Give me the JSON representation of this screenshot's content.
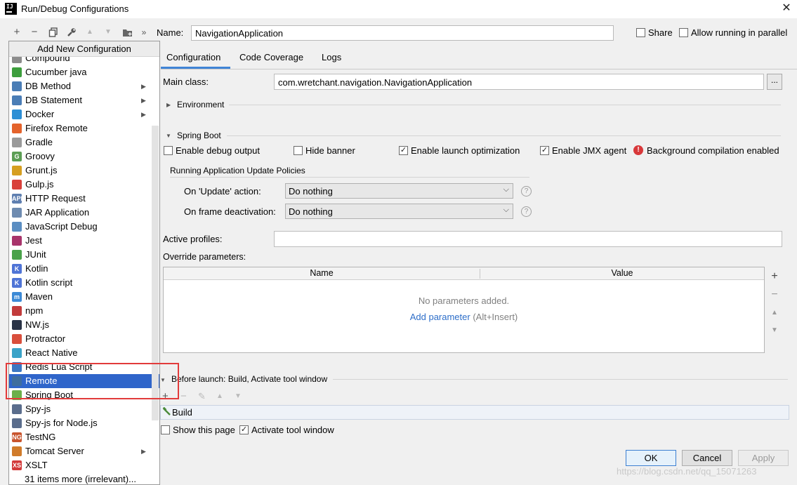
{
  "window": {
    "title": "Run/Debug Configurations",
    "logo_text": "IJ",
    "close_glyph": "✕"
  },
  "toolbar": {
    "icons": [
      "plus-icon",
      "minus-icon",
      "copy-icon",
      "wrench-icon",
      "arrow-up-icon",
      "arrow-down-icon",
      "folder-plus-icon",
      "double-chevron-right-icon"
    ],
    "name_label": "Name:",
    "name_value": "NavigationApplication",
    "share_label": "Share",
    "allow_parallel_label": "Allow running in parallel"
  },
  "popup": {
    "header": "Add New Configuration",
    "items": [
      {
        "label": "Compound",
        "icon": "compound-icon",
        "color": "#8c8c8c"
      },
      {
        "label": "Cucumber java",
        "icon": "cucumber-icon",
        "color": "#3d9e3d"
      },
      {
        "label": "DB Method",
        "icon": "db-method-icon",
        "color": "#4a7db6",
        "submenu": true
      },
      {
        "label": "DB Statement",
        "icon": "db-statement-icon",
        "color": "#4a7db6",
        "submenu": true
      },
      {
        "label": "Docker",
        "icon": "docker-icon",
        "color": "#2d8fd5",
        "submenu": true
      },
      {
        "label": "Firefox Remote",
        "icon": "firefox-icon",
        "color": "#e4632c"
      },
      {
        "label": "Gradle",
        "icon": "gradle-icon",
        "color": "#9a9a9a"
      },
      {
        "label": "Groovy",
        "icon": "groovy-icon",
        "color": "#5c9e55",
        "glyph": "G"
      },
      {
        "label": "Grunt.js",
        "icon": "grunt-icon",
        "color": "#d69f21"
      },
      {
        "label": "Gulp.js",
        "icon": "gulp-icon",
        "color": "#d9403a"
      },
      {
        "label": "HTTP Request",
        "icon": "http-request-icon",
        "color": "#5f7fb0",
        "glyph": "API"
      },
      {
        "label": "JAR Application",
        "icon": "jar-icon",
        "color": "#6e8bb0"
      },
      {
        "label": "JavaScript Debug",
        "icon": "javascript-debug-icon",
        "color": "#5b8ec2"
      },
      {
        "label": "Jest",
        "icon": "jest-icon",
        "color": "#a8346b"
      },
      {
        "label": "JUnit",
        "icon": "junit-icon",
        "color": "#4aa24a"
      },
      {
        "label": "Kotlin",
        "icon": "kotlin-icon",
        "color": "#4f74d6",
        "glyph": "K"
      },
      {
        "label": "Kotlin script",
        "icon": "kotlin-script-icon",
        "color": "#4f74d6",
        "glyph": "K"
      },
      {
        "label": "Maven",
        "icon": "maven-icon",
        "color": "#3c8ad6",
        "glyph": "m"
      },
      {
        "label": "npm",
        "icon": "npm-icon",
        "color": "#c23b3b"
      },
      {
        "label": "NW.js",
        "icon": "nwjs-icon",
        "color": "#2a3346"
      },
      {
        "label": "Protractor",
        "icon": "protractor-icon",
        "color": "#d94f3c"
      },
      {
        "label": "React Native",
        "icon": "react-native-icon",
        "color": "#3aa3c8"
      },
      {
        "label": "Redis Lua Script",
        "icon": "redis-lua-icon",
        "color": "#3d77c2"
      },
      {
        "label": "Remote",
        "icon": "remote-icon",
        "color": "#3e6d9e",
        "selected": true
      },
      {
        "label": "Spring Boot",
        "icon": "spring-boot-icon",
        "color": "#6bb04a"
      },
      {
        "label": "Spy-js",
        "icon": "spy-js-icon",
        "color": "#5a6d8c"
      },
      {
        "label": "Spy-js for Node.js",
        "icon": "spy-js-node-icon",
        "color": "#5a6d8c"
      },
      {
        "label": "TestNG",
        "icon": "testng-icon",
        "color": "#c9552e",
        "glyph": "NG"
      },
      {
        "label": "Tomcat Server",
        "icon": "tomcat-icon",
        "color": "#d07b2a",
        "submenu": true
      },
      {
        "label": "XSLT",
        "icon": "xslt-icon",
        "color": "#d33b3b",
        "glyph": "XS"
      },
      {
        "label": "31 items more (irrelevant)...",
        "icon": "",
        "color": "#ffffff"
      }
    ]
  },
  "tabs": [
    {
      "label": "Configuration",
      "active": true
    },
    {
      "label": "Code Coverage"
    },
    {
      "label": "Logs"
    }
  ],
  "config": {
    "main_class_label": "Main class:",
    "main_class_value": "com.wretchant.navigation.NavigationApplication",
    "browse_label": "...",
    "environment_label": "Environment",
    "spring_boot_label": "Spring Boot",
    "checkboxes": [
      {
        "label": "Enable debug output",
        "checked": false
      },
      {
        "label": "Hide banner",
        "checked": false
      },
      {
        "label": "Enable launch optimization",
        "checked": true
      },
      {
        "label": "Enable JMX agent",
        "checked": true
      }
    ],
    "background_compilation": "Background compilation enabled",
    "update_policies_label": "Running Application Update Policies",
    "on_update_label": "On 'Update' action:",
    "on_update_value": "Do nothing",
    "on_frame_label": "On frame deactivation:",
    "on_frame_value": "Do nothing",
    "active_profiles_label": "Active profiles:",
    "active_profiles_value": "",
    "override_label": "Override parameters:",
    "table": {
      "col_name": "Name",
      "col_value": "Value",
      "empty_text": "No parameters added.",
      "add_link": "Add parameter",
      "add_hint": " (Alt+Insert)"
    },
    "before_launch_label": "Before launch: Build, Activate tool window",
    "build_item": "Build",
    "show_page_label": "Show this page",
    "activate_tool_label": "Activate tool window"
  },
  "buttons": {
    "ok": "OK",
    "cancel": "Cancel",
    "apply": "Apply"
  },
  "watermark": "https://blog.csdn.net/qq_15071263",
  "colors": {
    "selection": "#2f65ca",
    "link": "#2d6ec9",
    "highlight_box": "#e23b3b",
    "tab_underline": "#4084d6"
  }
}
